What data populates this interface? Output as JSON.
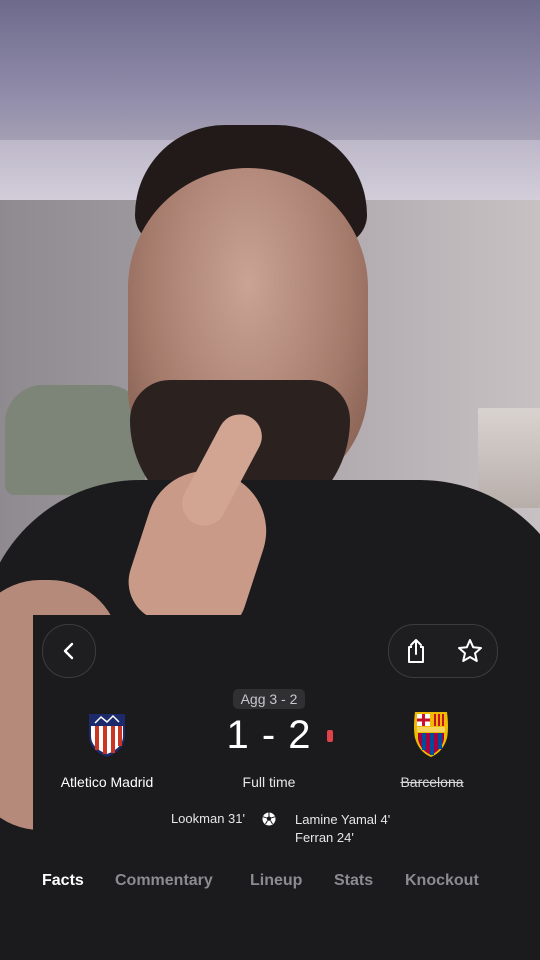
{
  "match": {
    "aggregate": "Agg 3 - 2",
    "score": "1 - 2",
    "status": "Full time",
    "home_team": "Atletico Madrid",
    "away_team": "Barcelona",
    "home_scorers": [
      "Lookman 31'"
    ],
    "away_scorers": [
      "Lamine Yamal 4'",
      "Ferran 24'"
    ]
  },
  "tabs": [
    {
      "label": "Facts"
    },
    {
      "label": "Commentary"
    },
    {
      "label": "Lineup"
    },
    {
      "label": "Stats"
    },
    {
      "label": "Knockout"
    }
  ],
  "icons": {
    "back": "chevron-left-icon",
    "share": "share-icon",
    "favorite": "star-icon",
    "goal": "football-icon"
  },
  "colors": {
    "card_bg": "#1b1b1d",
    "live_dot": "#e0414a",
    "tab_active": "#ffffff",
    "tab_inactive": "#8b8b90"
  }
}
